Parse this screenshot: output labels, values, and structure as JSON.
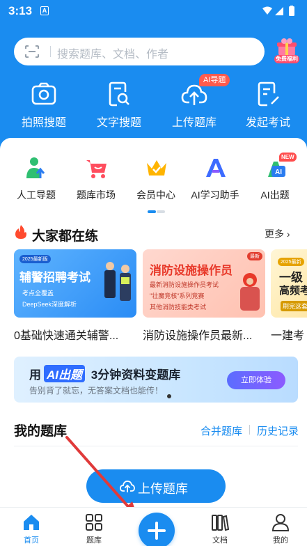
{
  "status_bar": {
    "time": "3:13",
    "notification_letter": "A"
  },
  "search": {
    "placeholder": "搜索题库、文档、作者"
  },
  "gift": {
    "label": "免费福利"
  },
  "tools": [
    {
      "label": "拍照搜题",
      "icon": "camera-icon"
    },
    {
      "label": "文字搜题",
      "icon": "document-search-icon"
    },
    {
      "label": "上传题库",
      "icon": "cloud-upload-icon",
      "tag": "AI导题"
    },
    {
      "label": "发起考试",
      "icon": "exam-edit-icon"
    }
  ],
  "quick_nav": [
    {
      "label": "人工导题",
      "icon": "person-upload-icon"
    },
    {
      "label": "题库市场",
      "icon": "shopping-cart-icon"
    },
    {
      "label": "会员中心",
      "icon": "crown-icon"
    },
    {
      "label": "AI学习助手",
      "icon": "ai-assistant-icon"
    },
    {
      "label": "AI出题",
      "icon": "ai-question-icon",
      "tag": "NEW"
    }
  ],
  "popular": {
    "title": "大家都在练",
    "more": "更多",
    "cards": [
      {
        "year_tag": "2025最新版",
        "title": "辅警招聘考试",
        "lines": [
          "考点全覆盖",
          "DeepSeek深度解析"
        ],
        "caption": "0基础快速通关辅警..."
      },
      {
        "year_tag": "最新",
        "title": "消防设施操作员",
        "lines": [
          "最新消防设施操作员考试",
          "\"壮魔竞核\"系列竞赛",
          "其他消防技能类考试"
        ],
        "caption": "消防设施操作员最新..."
      },
      {
        "year_tag": "2025最新",
        "title": "一级",
        "lines": [
          "高频考",
          "刷完这套"
        ],
        "caption": "一建考"
      }
    ]
  },
  "ad": {
    "prefix": "用",
    "chip": "AI出题",
    "title_rest": "3分钟资料变题库",
    "subtitle": "告别背了就忘，无答案文档也能传！",
    "button": "立即体验"
  },
  "my_library": {
    "title": "我的题库",
    "merge": "合并题库",
    "history": "历史记录",
    "upload_button": "上传题库"
  },
  "tabbar": [
    {
      "label": "首页",
      "icon": "home-icon",
      "active": true
    },
    {
      "label": "题库",
      "icon": "grid-icon",
      "active": false
    },
    {
      "label": "",
      "icon": "plus-icon",
      "active": false
    },
    {
      "label": "文档",
      "icon": "documents-icon",
      "active": false
    },
    {
      "label": "我的",
      "icon": "profile-icon",
      "active": false
    }
  ],
  "colors": {
    "primary": "#1a8cf0",
    "tag_red": "#ff5b4d",
    "annotation_arrow": "#e03a3a"
  }
}
